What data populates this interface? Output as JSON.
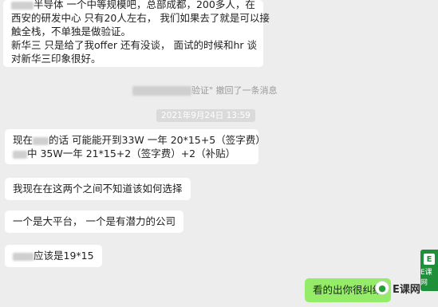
{
  "messages": {
    "m1": {
      "lines": [
        "半导体   一个中等规模吧，总部成都，200多人，在",
        "西安的研发中心 只有20人左右，  我们如果去了就是可以接",
        "触全栈，不单独是做验证。",
        " 新华三  只是给了我offer  还有没谈，  面试的时候和hr 谈",
        "对新华三印象很好。"
      ]
    },
    "recall_notice": "验证\" 撤回了一条消息",
    "timestamp": "2021年9月24日 13:59",
    "m2": {
      "line1_pre": "现在",
      "line1_post": "的话 可能能开到33W 一年  20*15+5（签字费）",
      "line2_post": "中  35W一年  21*15+2（签字费）+2（补贴）"
    },
    "m3": "我现在在这两个之间不知道该如何选择",
    "m4": "一个是大平台，  一个是有潜力的公司",
    "m5_post": "应该是19*15",
    "reply": "看的出你很纠结",
    "watermark": "E课网",
    "badge_text": "E课网",
    "badge_letter": "E"
  },
  "colors": {
    "background": "#ededed",
    "bubble": "#ffffff",
    "self_bubble": "#95ec69",
    "badge": "#1f8f3a"
  }
}
